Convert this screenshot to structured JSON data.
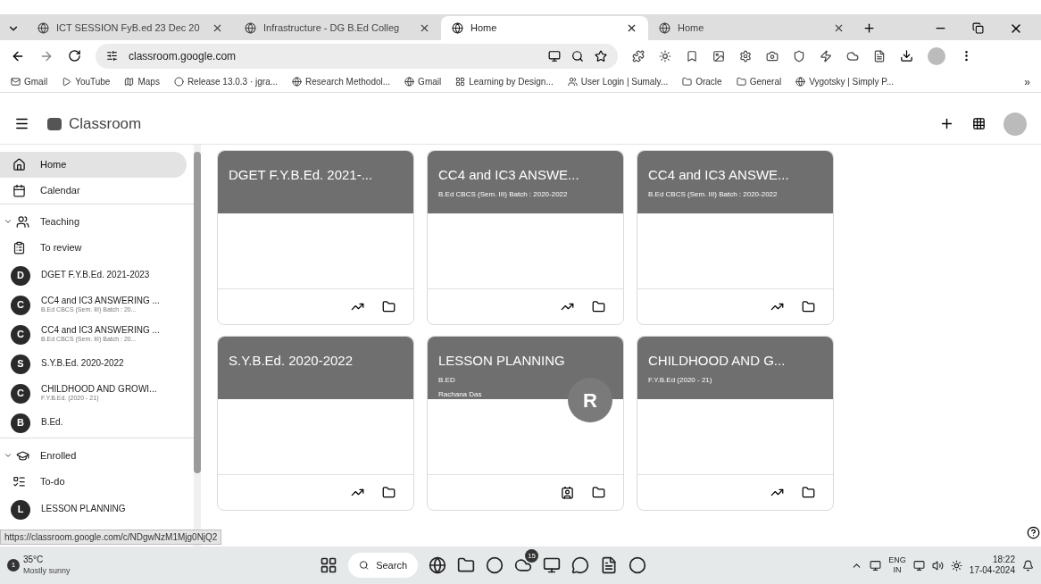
{
  "browser": {
    "tabs": [
      {
        "title": "ICT SESSION FyB.ed 23 Dec 20",
        "selected": false
      },
      {
        "title": "Infrastructure - DG B.Ed Colleg",
        "selected": false
      },
      {
        "title": "Home",
        "selected": true
      },
      {
        "title": "Home",
        "selected": false
      }
    ],
    "address": "classroom.google.com",
    "bookmarks": [
      "Gmail",
      "YouTube",
      "Maps",
      "Release 13.0.3 · jgra...",
      "Research Methodol...",
      "Gmail",
      "Learning by Design...",
      "User Login | Sumaly...",
      "Oracle",
      "General",
      "Vygotsky | Simply P..."
    ],
    "bookmarks_more": "»"
  },
  "app": {
    "title": "Classroom"
  },
  "sidebar": {
    "items": [
      {
        "kind": "nav",
        "label": "Home",
        "selected": true
      },
      {
        "kind": "nav",
        "label": "Calendar",
        "selected": false
      },
      {
        "kind": "section",
        "label": "Teaching",
        "expanded": true,
        "children": [
          {
            "kind": "nav",
            "label": "To review",
            "selected": false
          },
          {
            "kind": "class",
            "letter": "D",
            "label": "DGET F.Y.B.Ed. 2021-2023",
            "selected": false
          },
          {
            "kind": "class",
            "letter": "C",
            "label": "CC4 and IC3 ANSWERING ...",
            "subtitle": "B.Ed CBCS (Sem. III) Batch : 20...",
            "selected": false
          },
          {
            "kind": "class",
            "letter": "C",
            "label": "CC4 and IC3 ANSWERING ...",
            "subtitle": "B.Ed CBCS (Sem. III) Batch : 20...",
            "selected": false
          },
          {
            "kind": "class",
            "letter": "S",
            "label": "S.Y.B.Ed. 2020-2022",
            "selected": false
          },
          {
            "kind": "class",
            "letter": "C",
            "label": "CHILDHOOD AND GROWI...",
            "subtitle": "F.Y.B.Ed. (2020 - 21)",
            "selected": false
          },
          {
            "kind": "class",
            "letter": "B",
            "label": "B.Ed.",
            "selected": false
          }
        ]
      },
      {
        "kind": "section",
        "label": "Enrolled",
        "expanded": true,
        "children": [
          {
            "kind": "nav",
            "label": "To-do",
            "selected": false
          },
          {
            "kind": "class",
            "letter": "L",
            "label": "LESSON PLANNING",
            "selected": false
          }
        ]
      }
    ]
  },
  "cards": [
    {
      "kind": "teaching",
      "title": "DGET F.Y.B.Ed. 2021-..."
    },
    {
      "kind": "teaching",
      "title": "CC4 and IC3 ANSWE...",
      "subtitle": "B.Ed CBCS (Sem. III) Batch : 2020-2022"
    },
    {
      "kind": "teaching",
      "title": "CC4 and IC3 ANSWE...",
      "subtitle": "B.Ed CBCS (Sem. III) Batch : 2020-2022"
    },
    {
      "kind": "teaching",
      "title": "S.Y.B.Ed. 2020-2022"
    },
    {
      "kind": "enrolled",
      "title": "LESSON PLANNING",
      "subtitle": "B.ED",
      "teacher": "Rachana Das",
      "avatar": "R"
    },
    {
      "kind": "teaching",
      "title": "CHILDHOOD AND G...",
      "subtitle": "F.Y.B.Ed (2020 - 21)"
    }
  ],
  "status_url": "https://classroom.google.com/c/NDgwNzM1Mjg0NjQ2",
  "taskbar": {
    "weather": {
      "temp": "35°C",
      "condition": "Mostly sunny",
      "badge": "1"
    },
    "search": "Search",
    "notification_badge": "15",
    "language": "ENG",
    "region": "IN",
    "time": "18:22",
    "date": "17-04-2024"
  }
}
